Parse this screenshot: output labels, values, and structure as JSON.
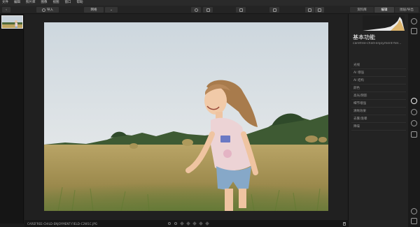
{
  "menu": {
    "items": [
      "文件",
      "编辑",
      "照片库",
      "图像",
      "视图",
      "窗口",
      "帮助"
    ]
  },
  "toolbar": {
    "back_label": "",
    "back_icon": "arrow-left-icon",
    "import_label": "导入",
    "view_label": "网格",
    "tabs": [
      "资料库",
      "编辑",
      "图层/导出"
    ]
  },
  "filmstrip": {
    "thumbs": 1
  },
  "image": {
    "subject": "girl running in wheat field",
    "filename": "CAREFREE-CHILD-ENJOYMENT-FIELD-C2W1C.JPG"
  },
  "panel": {
    "title": "基本功能",
    "subtitle": "carefree-child-enjoyment-fiel...",
    "sections": [
      "光线",
      "AI 增强",
      "AI 结构",
      "颜色",
      "高光/阴影",
      "细节增强",
      "清晰效果",
      "去雾/渐晕",
      "降噪"
    ]
  },
  "colors": {
    "accent": "#ffffff",
    "panel_bg": "#232323",
    "canvas_bg": "#202020"
  }
}
